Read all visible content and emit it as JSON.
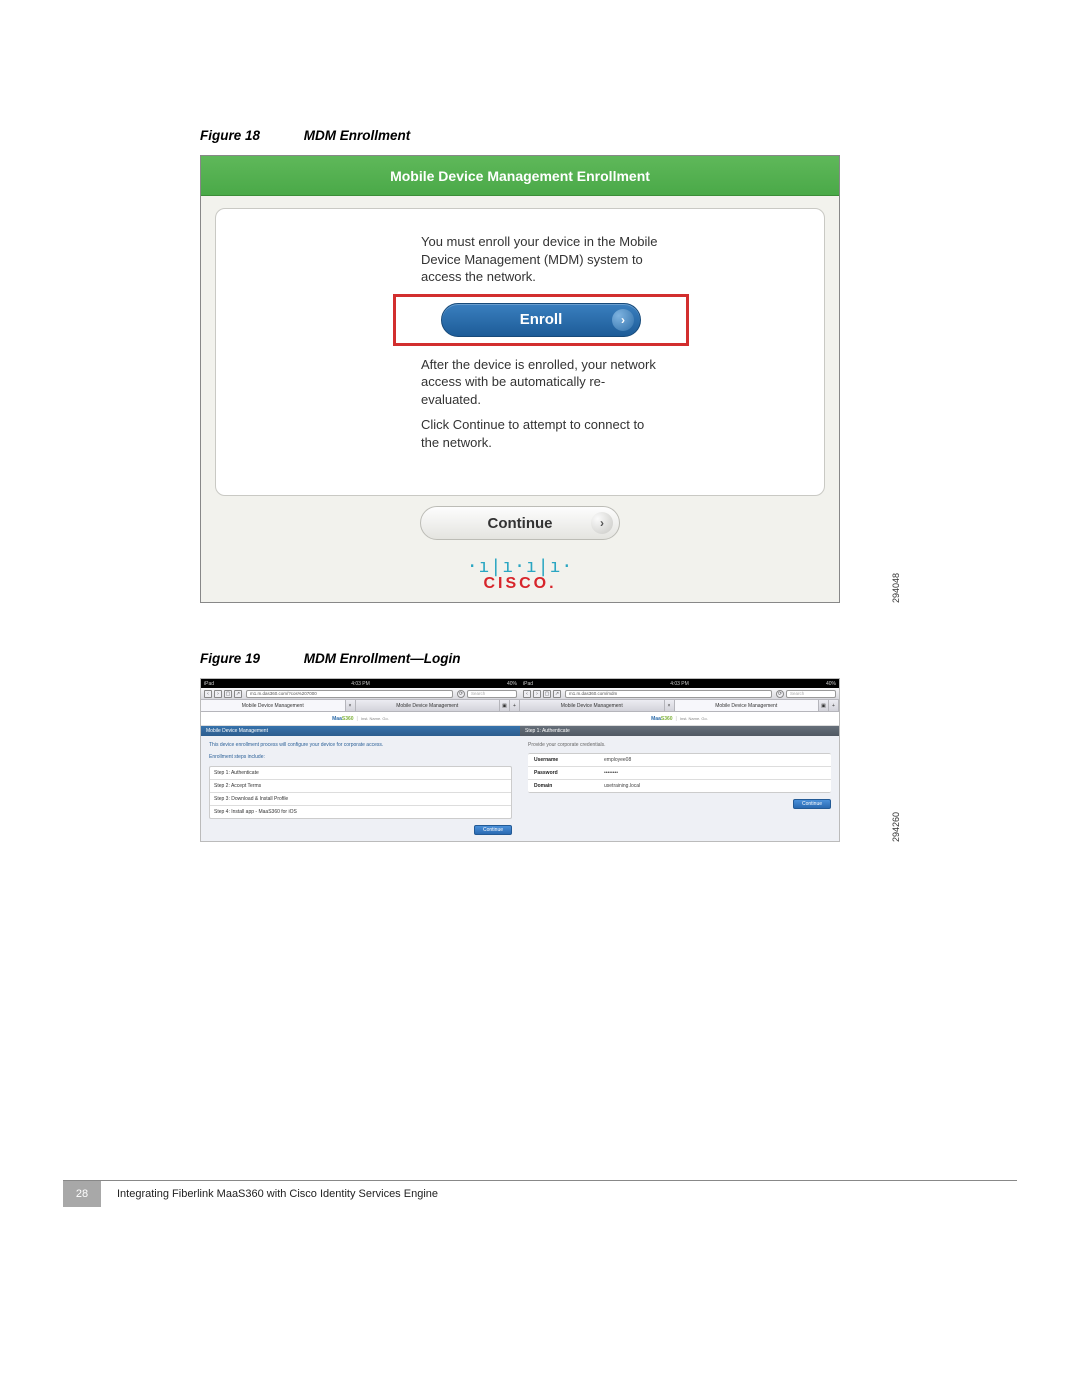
{
  "figure18": {
    "caption_num": "Figure 18",
    "caption_title": "MDM Enrollment",
    "header": "Mobile Device Management Enrollment",
    "msg1": "You must enroll your device in the Mobile Device Management (MDM) system to access the network.",
    "enroll_label": "Enroll",
    "msg2": "After the device is enrolled, your network access with be automatically re-evaluated.",
    "msg3": "Click Continue to attempt to connect to the network.",
    "continue_label": "Continue",
    "cisco_text": "CISCO.",
    "img_code": "294048"
  },
  "figure19": {
    "caption_num": "Figure 19",
    "caption_title": "MDM Enrollment—Login",
    "img_code": "294260",
    "status": {
      "left": "iPad",
      "center": "4:03 PM",
      "right": "40%"
    },
    "toolbar": {
      "url1": "m1.m.das360.com/?cos%207000",
      "url2": "m1.m.das360.com/mdm",
      "search": "Search"
    },
    "tabs": {
      "left": "Mobile Device Management",
      "right": "Mobile Device Management",
      "close": "×",
      "add": "+"
    },
    "brand": {
      "name1": "Maa",
      "name2": "S360",
      "by": "Inst. Name. Go."
    },
    "left_panel": {
      "section": "Mobile Device Management",
      "intro": "This device enrollment process will configure your device for corporate access.",
      "subtitle": "Enrollment steps include:",
      "steps": [
        "Step 1: Authenticate",
        "Step 2: Accept Terms",
        "Step 3: Download & Install Profile",
        "Step 4: Install app - MaaS360 for iOS"
      ],
      "btn": "Continue"
    },
    "right_panel": {
      "section": "Step 1: Authenticate",
      "sub": "Provide your corporate credentials.",
      "rows": [
        {
          "label": "Username",
          "value": "employee08"
        },
        {
          "label": "Password",
          "value": "••••••••"
        },
        {
          "label": "Domain",
          "value": "usetraining.local"
        }
      ],
      "btn": "Continue"
    }
  },
  "footer": {
    "page": "28",
    "title": "Integrating Fiberlink MaaS360 with Cisco Identity Services Engine"
  }
}
